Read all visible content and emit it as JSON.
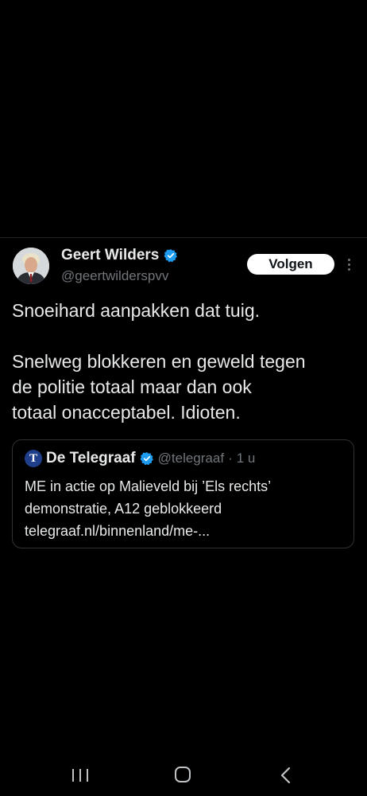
{
  "tweet": {
    "author": {
      "name": "Geert Wilders",
      "handle": "@geertwilderspvv",
      "verified": true,
      "avatar_icon": "person-photo"
    },
    "follow_label": "Volgen",
    "more_icon": "vertical-ellipsis",
    "text_lines": {
      "line1": "Snoeihard aanpakken dat tuig.",
      "line2": "Snelweg blokkeren en geweld tegen",
      "line3": "de politie totaal maar dan ook",
      "line4": "totaal onacceptabel. Idioten."
    },
    "quote": {
      "avatar_glyph": "T",
      "name": "De Telegraaf",
      "verified": true,
      "handle": "@telegraaf",
      "separator": "·",
      "time": "1 u",
      "text_lines": {
        "line1": "ME in actie op Malieveld bij ’Els rechts’",
        "line2": "demonstratie, A12 geblokkeerd",
        "line3": "telegraaf.nl/binnenland/me-..."
      }
    }
  },
  "nav_bar": {
    "recent_icon": "recent-apps-icon",
    "home_icon": "home-icon",
    "back_icon": "back-icon"
  },
  "colors": {
    "background": "#000000",
    "text_primary": "#e7e9ea",
    "text_secondary": "#71767b",
    "verified_blue": "#1d9bf0",
    "border": "#2f3336"
  }
}
